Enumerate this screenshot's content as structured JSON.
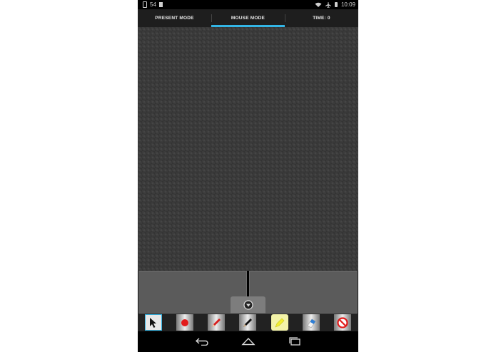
{
  "status_bar": {
    "notification_count": "54",
    "time": "10:09"
  },
  "tabs": [
    {
      "label": "PRESENT MODE",
      "active": false
    },
    {
      "label": "MOUSE MODE",
      "active": true
    },
    {
      "label": "TIME: 0",
      "active": false
    }
  ],
  "colors": {
    "accent": "#33b5e5",
    "touchpad": "#3b3b3b",
    "mouse_button": "#5b5b5b"
  },
  "toolbar": {
    "tools": [
      {
        "icon": "pointer-arrow-icon",
        "selected": true
      },
      {
        "icon": "red-dot-icon",
        "selected": false
      },
      {
        "icon": "red-pen-icon",
        "selected": false
      },
      {
        "icon": "black-pen-icon",
        "selected": false
      },
      {
        "icon": "highlighter-icon",
        "selected": false
      },
      {
        "icon": "eraser-icon",
        "selected": false
      },
      {
        "icon": "clear-icon",
        "selected": false
      }
    ]
  },
  "nav_bar": {
    "icons": [
      "back-icon",
      "home-icon",
      "recent-apps-icon"
    ]
  }
}
